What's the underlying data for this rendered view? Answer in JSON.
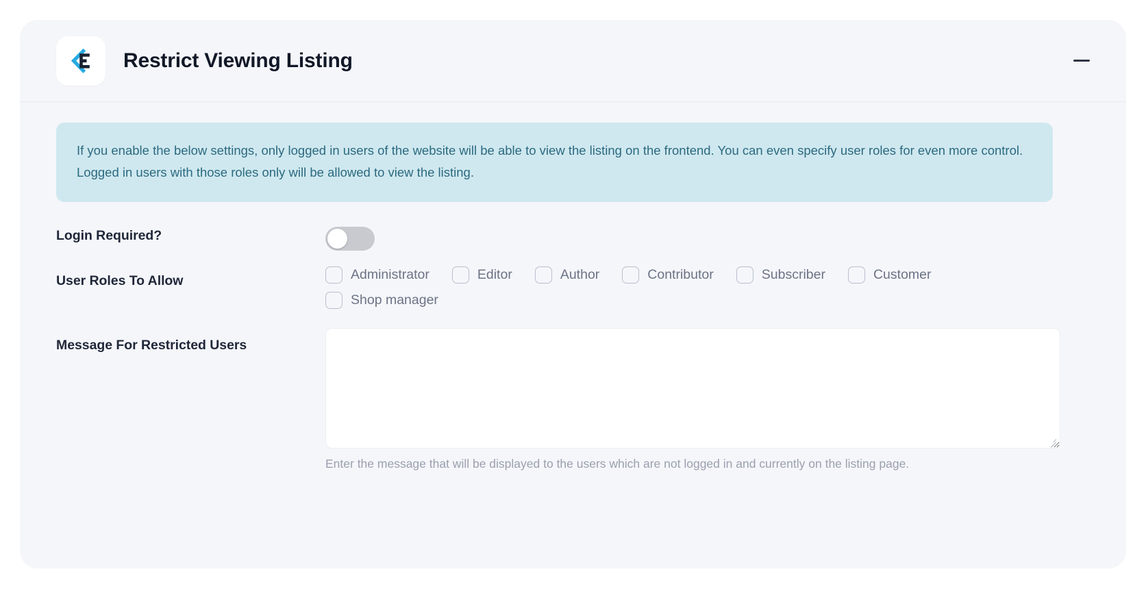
{
  "metabox": {
    "title": "Restrict Viewing Listing",
    "logo_icon": "chevron-left-e-logo-icon",
    "collapse_icon": "minus-icon",
    "collapse_label": "Collapse panel",
    "accent_color": "#27aae1",
    "notice": {
      "text": "If you enable the below settings, only logged in users of the website will be able to view the listing on the frontend. You can even specify user roles for even more control. Logged in users with those roles only will be allowed to view the listing.",
      "background": "#cfe8ef",
      "text_color": "#2c6a80"
    },
    "fields": {
      "login_required": {
        "label": "Login Required?",
        "toggle_state": "off"
      },
      "user_roles": {
        "label": "User Roles To Allow",
        "options": [
          {
            "label": "Administrator",
            "checked": false
          },
          {
            "label": "Editor",
            "checked": false
          },
          {
            "label": "Author",
            "checked": false
          },
          {
            "label": "Contributor",
            "checked": false
          },
          {
            "label": "Subscriber",
            "checked": false
          },
          {
            "label": "Customer",
            "checked": false
          },
          {
            "label": "Shop manager",
            "checked": false
          }
        ]
      },
      "message": {
        "label": "Message For Restricted Users",
        "value": "",
        "placeholder": "",
        "help": "Enter the message that will be displayed to the users which are not logged in and currently on the listing page."
      }
    }
  }
}
